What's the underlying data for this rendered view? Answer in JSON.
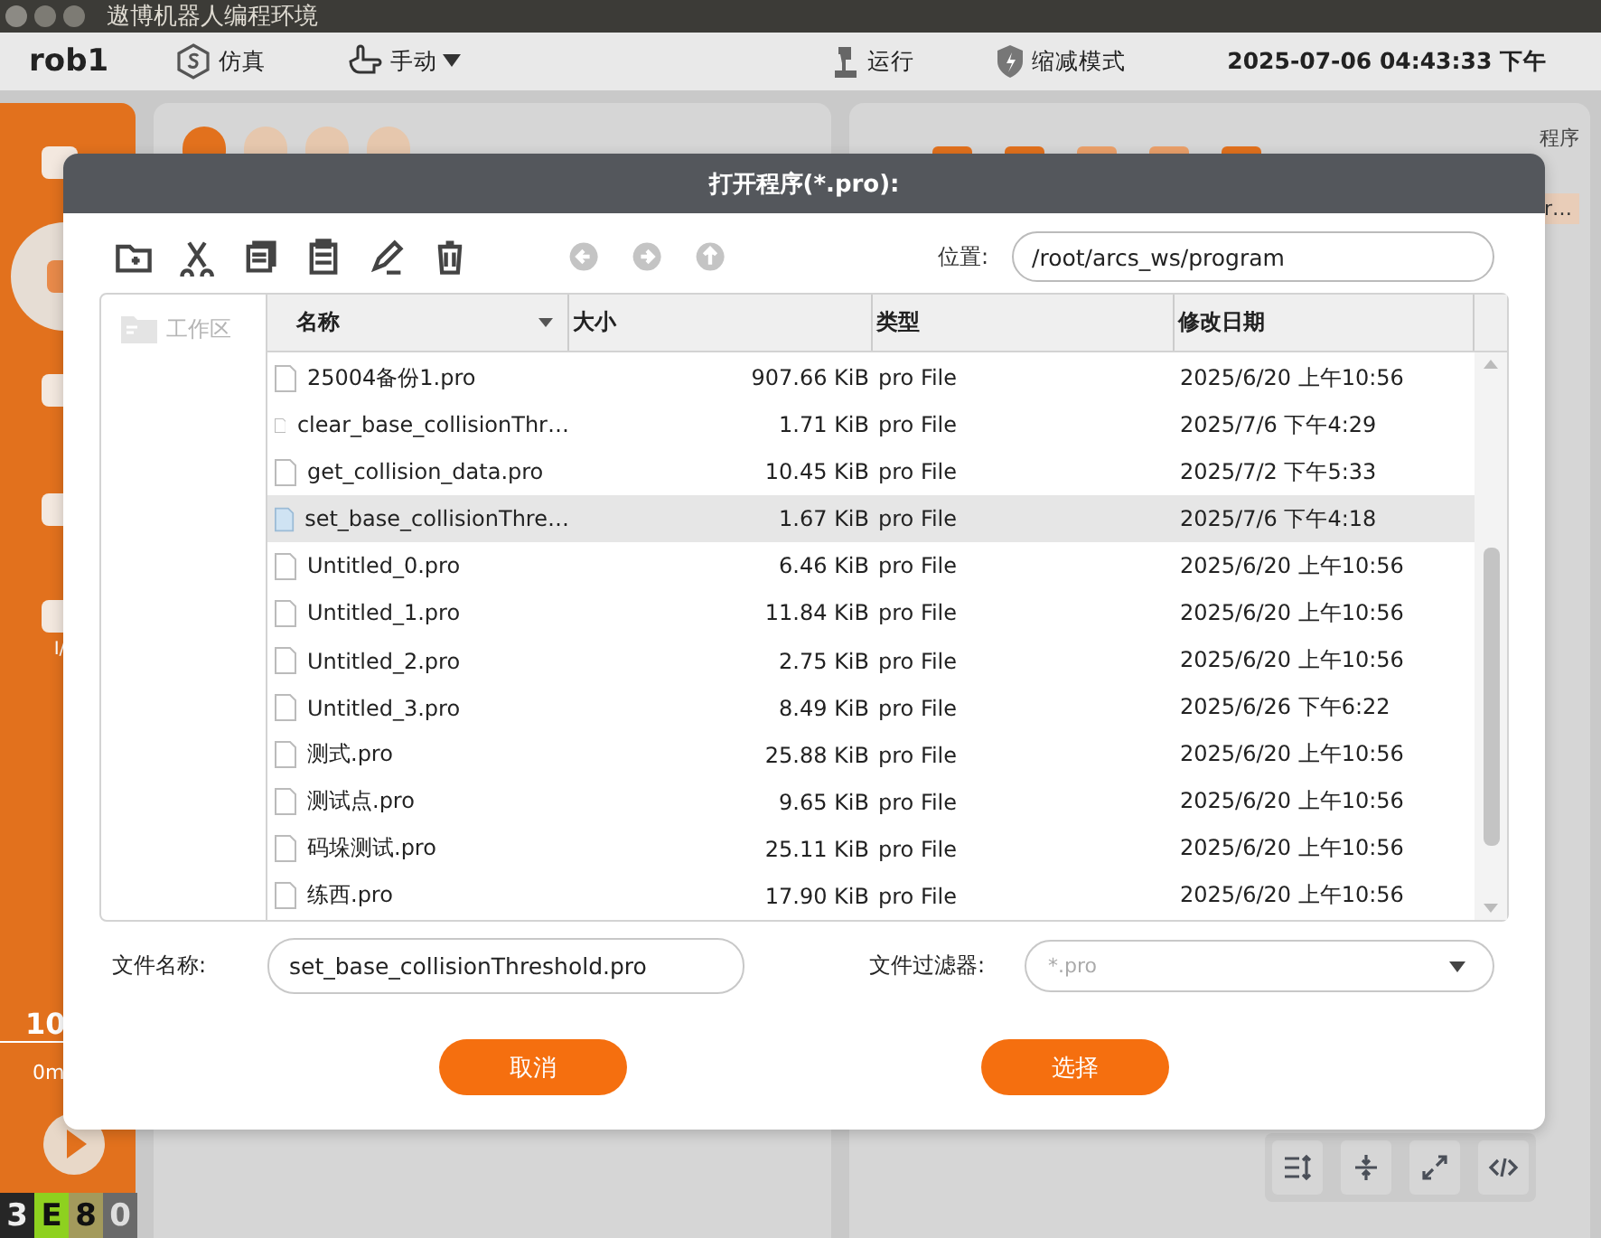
{
  "window": {
    "title": "遨博机器人编程环境"
  },
  "toolbar": {
    "robot": "rob1",
    "items": [
      {
        "kind": "simulation",
        "label": "仿真",
        "dropdown": false
      },
      {
        "kind": "hand",
        "label": "手动",
        "dropdown": true
      },
      {
        "kind": "robot",
        "label": "运行",
        "dropdown": false
      },
      {
        "kind": "shield",
        "label": "缩减模式",
        "dropdown": false
      }
    ],
    "datetime": "2025-07-06 04:43:33 下午"
  },
  "sidebar": {
    "items": [
      {
        "selected": false
      },
      {
        "selected": true
      },
      {
        "selected": false
      },
      {
        "selected": false
      },
      {
        "label": "I/",
        "selected": false
      }
    ],
    "speed": "10",
    "speed_unit": "0m"
  },
  "status_chips": [
    {
      "label": "3",
      "color": "#262626"
    },
    {
      "label": "E",
      "color": "#8ed11f"
    },
    {
      "label": "8",
      "color": "#a39a5c"
    },
    {
      "label": "0",
      "color": "#6a6a6a"
    }
  ],
  "left_panel": {
    "tabs": [
      {
        "selected": true
      },
      {
        "selected": false
      },
      {
        "selected": false
      },
      {
        "selected": false
      }
    ]
  },
  "right_panel": {
    "label": "程序",
    "value": "r…"
  },
  "bottom_tools": [
    {
      "kind": "sort"
    },
    {
      "kind": "collapse"
    },
    {
      "kind": "expand"
    },
    {
      "kind": "code"
    }
  ],
  "dialog": {
    "title": "打开程序(*.pro):",
    "tools": [
      {
        "kind": "new-folder",
        "disabled": false
      },
      {
        "kind": "cut",
        "disabled": false
      },
      {
        "kind": "copy",
        "disabled": false
      },
      {
        "kind": "paste",
        "disabled": false
      },
      {
        "kind": "rename",
        "disabled": false
      },
      {
        "kind": "delete",
        "disabled": false
      },
      {
        "kind": "back",
        "disabled": true
      },
      {
        "kind": "forward",
        "disabled": true
      },
      {
        "kind": "up",
        "disabled": true
      }
    ],
    "location_label": "位置:",
    "location": "/root/arcs_ws/program",
    "places": [
      {
        "label": "工作区",
        "disabled": true
      }
    ],
    "columns": [
      {
        "label": "名称",
        "sorted": true
      },
      {
        "label": "大小",
        "sorted": false
      },
      {
        "label": "类型",
        "sorted": false
      },
      {
        "label": "修改日期",
        "sorted": false
      }
    ],
    "rows": [
      {
        "name": "25004备份1.pro",
        "size": "907.66 KiB",
        "type": "pro File",
        "date": "2025/6/20 上午10:56",
        "selected": false
      },
      {
        "name": "clear_base_collisionThr…",
        "size": "1.71 KiB",
        "type": "pro File",
        "date": "2025/7/6 下午4:29",
        "selected": false
      },
      {
        "name": "get_collision_data.pro",
        "size": "10.45 KiB",
        "type": "pro File",
        "date": "2025/7/2 下午5:33",
        "selected": false
      },
      {
        "name": "set_base_collisionThre…",
        "size": "1.67 KiB",
        "type": "pro File",
        "date": "2025/7/6 下午4:18",
        "selected": true
      },
      {
        "name": "Untitled_0.pro",
        "size": "6.46 KiB",
        "type": "pro File",
        "date": "2025/6/20 上午10:56",
        "selected": false
      },
      {
        "name": "Untitled_1.pro",
        "size": "11.84 KiB",
        "type": "pro File",
        "date": "2025/6/20 上午10:56",
        "selected": false
      },
      {
        "name": "Untitled_2.pro",
        "size": "2.75 KiB",
        "type": "pro File",
        "date": "2025/6/20 上午10:56",
        "selected": false
      },
      {
        "name": "Untitled_3.pro",
        "size": "8.49 KiB",
        "type": "pro File",
        "date": "2025/6/26 下午6:22",
        "selected": false
      },
      {
        "name": "测式.pro",
        "size": "25.88 KiB",
        "type": "pro File",
        "date": "2025/6/20 上午10:56",
        "selected": false
      },
      {
        "name": "测试点.pro",
        "size": "9.65 KiB",
        "type": "pro File",
        "date": "2025/6/20 上午10:56",
        "selected": false
      },
      {
        "name": "码垛测试.pro",
        "size": "25.11 KiB",
        "type": "pro File",
        "date": "2025/6/20 上午10:56",
        "selected": false
      },
      {
        "name": "练西.pro",
        "size": "17.90 KiB",
        "type": "pro File",
        "date": "2025/6/20 上午10:56",
        "selected": false
      }
    ],
    "filename_label": "文件名称:",
    "filename": "set_base_collisionThreshold.pro",
    "filter_label": "文件过滤器:",
    "filter_placeholder": "*.pro",
    "buttons": [
      {
        "label": "取消"
      },
      {
        "label": "选择"
      }
    ]
  }
}
